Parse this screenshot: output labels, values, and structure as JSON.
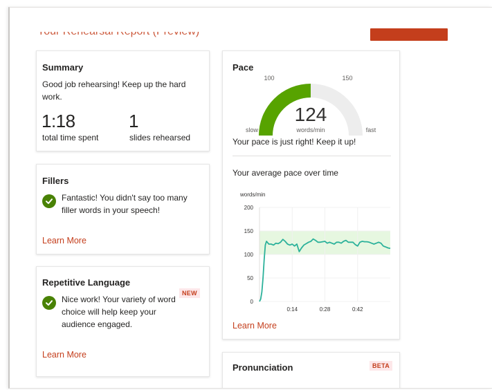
{
  "header": {
    "title": "Your Rehearsal Report (Preview)"
  },
  "summary": {
    "title": "Summary",
    "message": "Good job rehearsing! Keep up the hard work.",
    "time_value": "1:18",
    "time_label": "total time spent",
    "slides_value": "1",
    "slides_label": "slides rehearsed"
  },
  "fillers": {
    "title": "Fillers",
    "message": "Fantastic! You didn't say too many filler words in your speech!",
    "learn_more": "Learn More"
  },
  "repetitive": {
    "title": "Repetitive Language",
    "badge": "NEW",
    "message": "Nice work! Your variety of word choice will help keep your audience engaged.",
    "learn_more": "Learn More"
  },
  "pace": {
    "title": "Pace",
    "gauge": {
      "value": "124",
      "unit": "words/min",
      "label_low": "100",
      "label_high": "150",
      "slow_label": "slow",
      "fast_label": "fast",
      "fill_fraction": 0.5,
      "color_fill": "#57a300",
      "color_track": "#ededed"
    },
    "message": "Your pace is just right! Keep it up!",
    "chart_title": "Your average pace over time",
    "learn_more": "Learn More"
  },
  "pronunciation": {
    "title": "Pronunciation",
    "badge": "BETA"
  },
  "chart_data": {
    "type": "line",
    "title": "Your average pace over time",
    "ylabel": "words/min",
    "xlabel": "",
    "ylim": [
      0,
      200
    ],
    "yticks": [
      "0",
      "50",
      "100",
      "150",
      "200"
    ],
    "xlim": [
      0,
      56
    ],
    "xticks": [
      {
        "t": 14,
        "label": "0:14"
      },
      {
        "t": 28,
        "label": "0:28"
      },
      {
        "t": 42,
        "label": "0:42"
      }
    ],
    "band": {
      "low": 100,
      "high": 150,
      "color": "#e6f7e0"
    },
    "series": [
      {
        "color": "#2bb19a",
        "x": [
          0,
          0.5,
          1,
          1.5,
          2,
          2.5,
          3,
          3.5,
          4,
          5,
          6,
          7,
          8,
          9,
          10,
          11,
          12,
          13,
          14,
          15,
          16,
          17,
          18,
          19,
          20,
          21,
          22,
          23,
          24,
          25,
          26,
          27,
          28,
          29,
          30,
          31,
          32,
          33,
          34,
          35,
          36,
          37,
          38,
          39,
          40,
          41,
          42,
          43,
          44,
          45,
          46,
          47,
          48,
          49,
          50,
          51,
          52,
          53,
          54,
          55,
          56
        ],
        "y": [
          0,
          5,
          20,
          50,
          90,
          120,
          128,
          125,
          122,
          122,
          120,
          124,
          123,
          126,
          132,
          128,
          122,
          120,
          122,
          118,
          122,
          106,
          114,
          120,
          123,
          126,
          128,
          133,
          130,
          126,
          126,
          127,
          128,
          124,
          126,
          124,
          122,
          126,
          126,
          124,
          128,
          130,
          126,
          126,
          126,
          121,
          118,
          126,
          128,
          127,
          127,
          126,
          124,
          122,
          124,
          126,
          124,
          118,
          116,
          114,
          113
        ]
      }
    ]
  }
}
